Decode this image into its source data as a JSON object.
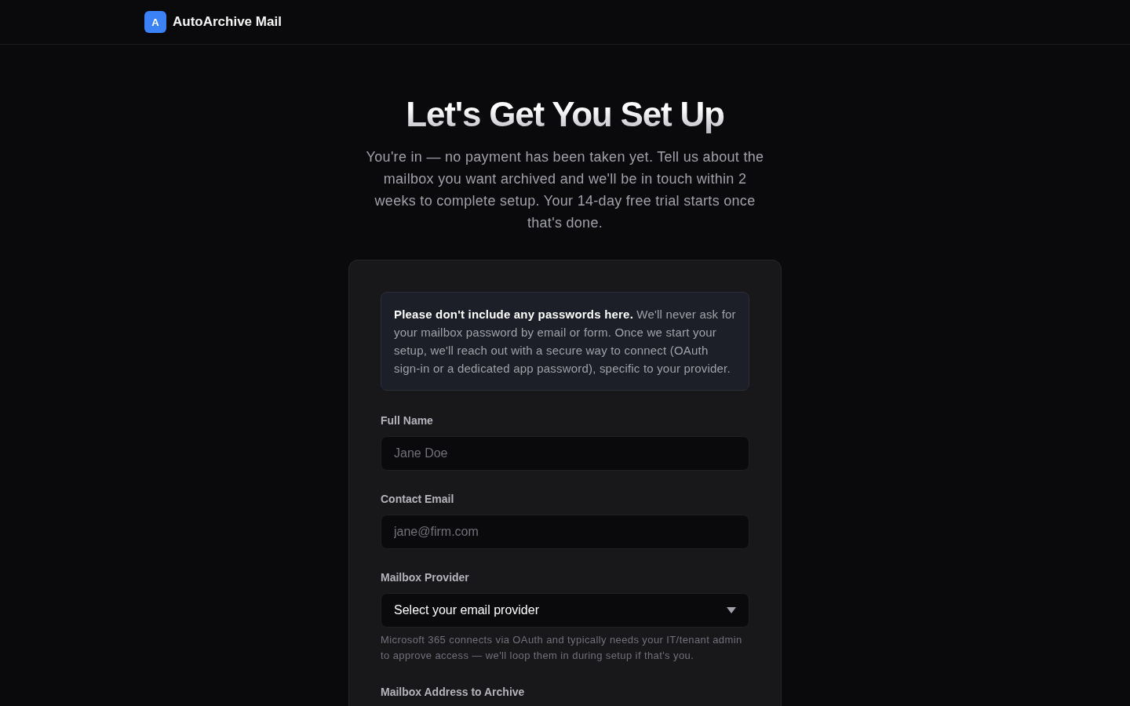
{
  "header": {
    "logo_letter": "A",
    "brand": "AutoArchive Mail"
  },
  "hero": {
    "title": "Let's Get You Set Up",
    "subtitle": "You're in — no payment has been taken yet. Tell us about the mailbox you want archived and we'll be in touch within 2 weeks to complete setup. Your 14-day free trial starts once that's done."
  },
  "form": {
    "notice": "**Please don't include any passwords here.** We'll never ask for your mailbox password by email or form. Once we start your setup, we'll reach out with a secure way to connect (OAuth sign-in or a dedicated app password), specific to your provider.",
    "fields": [
      {
        "kind": "text",
        "label": "Full Name",
        "placeholder": "Jane Doe"
      },
      {
        "kind": "text",
        "label": "Contact Email",
        "placeholder": "jane@firm.com"
      },
      {
        "kind": "select",
        "label": "Mailbox Provider",
        "value": "Select your email provider",
        "hint": "Microsoft 365 connects via OAuth and typically needs your IT/tenant admin to approve access — we'll loop them in during setup if that's you."
      },
      {
        "kind": "text",
        "label": "Mailbox Address to Archive"
      }
    ]
  }
}
